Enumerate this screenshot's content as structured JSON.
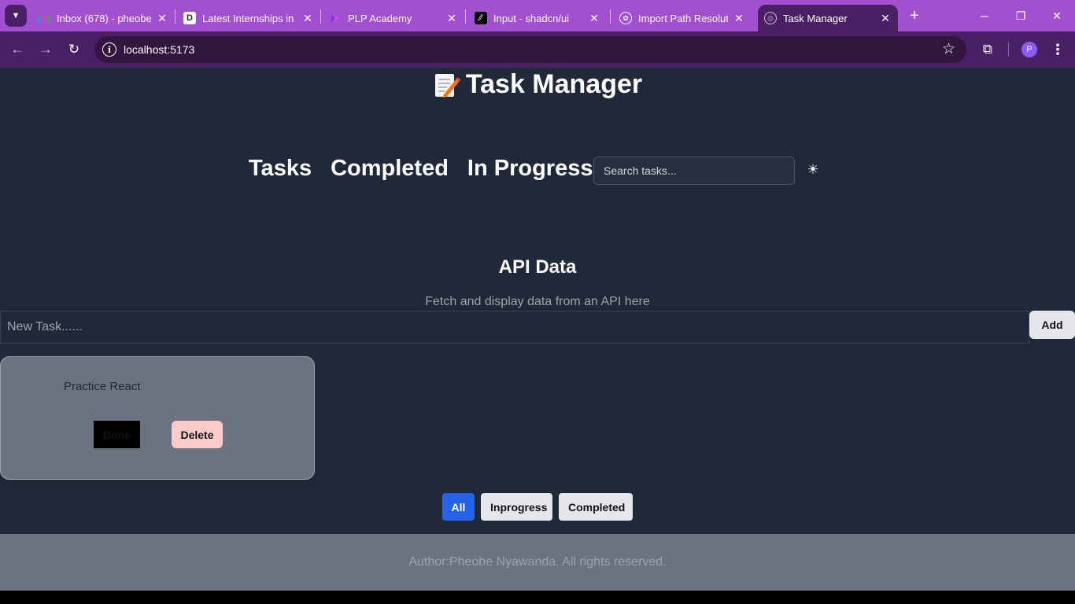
{
  "browser": {
    "tabs": [
      {
        "title": "Inbox (678) - pheobe",
        "favicon": "gmail-icon"
      },
      {
        "title": "Latest Internships in K",
        "favicon": "internship-site-icon"
      },
      {
        "title": "PLP Academy",
        "favicon": "plp-icon"
      },
      {
        "title": "Input - shadcn/ui",
        "favicon": "shadcn-icon"
      },
      {
        "title": "Import Path Resolutio",
        "favicon": "chatgpt-icon"
      },
      {
        "title": "Task Manager",
        "favicon": "globe-icon",
        "active": true
      }
    ],
    "url": "localhost:5173",
    "profile_initial": "P"
  },
  "app": {
    "title": "Task Manager",
    "title_icon": "memo-icon",
    "nav": [
      "Tasks",
      "Completed",
      "In Progress"
    ],
    "search_placeholder": "Search tasks...",
    "theme_icon": "☀"
  },
  "api": {
    "title": "API Data",
    "description": "Fetch and display data from an API here"
  },
  "task_form": {
    "placeholder": "New Task......",
    "add_label": "Add"
  },
  "tasks": [
    {
      "text": "Practice React",
      "done_label": "Done",
      "delete_label": "Delete"
    }
  ],
  "filters": {
    "all": "All",
    "inprogress": "Inprogress",
    "completed": "Completed",
    "active": "all"
  },
  "footer": {
    "text": "Author:Pheobe Nyawanda. All rights reserved."
  },
  "colors": {
    "browser_frame": "#a24fd1",
    "page_bg": "#1f2937",
    "card_bg": "#6b7280",
    "accent": "#2563eb",
    "delete": "#fecaca"
  }
}
